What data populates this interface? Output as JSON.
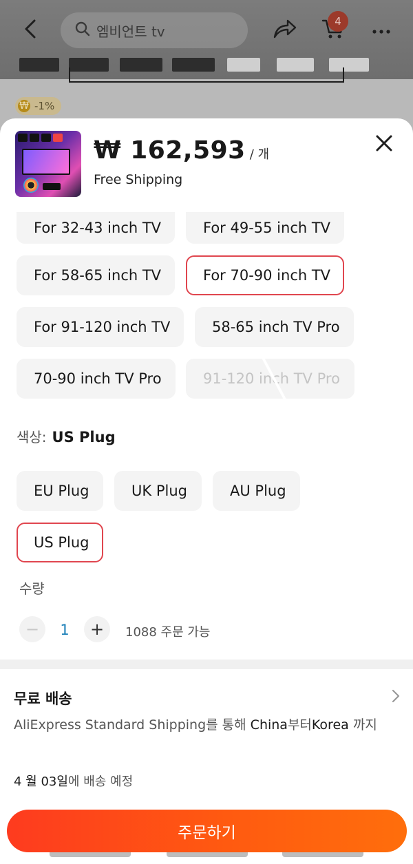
{
  "background_page": {
    "search_placeholder": "엠비언트 tv",
    "cart_count": "4",
    "discount_badge": "-1%",
    "coin_symbol": "₩"
  },
  "sheet": {
    "price": "₩ 162,593",
    "price_unit": "/ 개",
    "shipping_note": "Free Shipping",
    "size_options": [
      {
        "label": "For 32-43 inch TV",
        "state": "normal"
      },
      {
        "label": "For 49-55 inch TV",
        "state": "normal"
      },
      {
        "label": "For 58-65 inch TV",
        "state": "normal"
      },
      {
        "label": "For 70-90 inch TV",
        "state": "selected"
      },
      {
        "label": "For 91-120 inch TV",
        "state": "normal"
      },
      {
        "label": "58-65 inch TV Pro",
        "state": "normal"
      },
      {
        "label": "70-90 inch TV Pro",
        "state": "normal"
      },
      {
        "label": "91-120 inch TV Pro",
        "state": "disabled"
      }
    ],
    "color_label": "색상:",
    "color_value": "US Plug",
    "plug_options": [
      {
        "label": "EU Plug",
        "state": "normal"
      },
      {
        "label": "UK Plug",
        "state": "normal"
      },
      {
        "label": "AU Plug",
        "state": "normal"
      },
      {
        "label": "US Plug",
        "state": "selected"
      }
    ],
    "quantity_label": "수량",
    "quantity": {
      "minus": "−",
      "value": "1",
      "plus": "+",
      "available": "1088 주문 가능"
    },
    "shipping": {
      "title": "무료 배송",
      "desc_prefix": "AliExpress Standard Shipping를 통해 ",
      "from": "China",
      "from_suffix": "부터",
      "to": "Korea",
      "to_suffix": " 까지"
    },
    "delivery": {
      "date": "4 월 03일",
      "suffix": "에 배송 예정"
    },
    "order_button": "주문하기"
  },
  "colors": {
    "accent_red": "#e0464f",
    "button_gradient_start": "#fe3b1f",
    "button_gradient_end": "#ff6e0c",
    "stepper_value": "#1b7fb8"
  }
}
